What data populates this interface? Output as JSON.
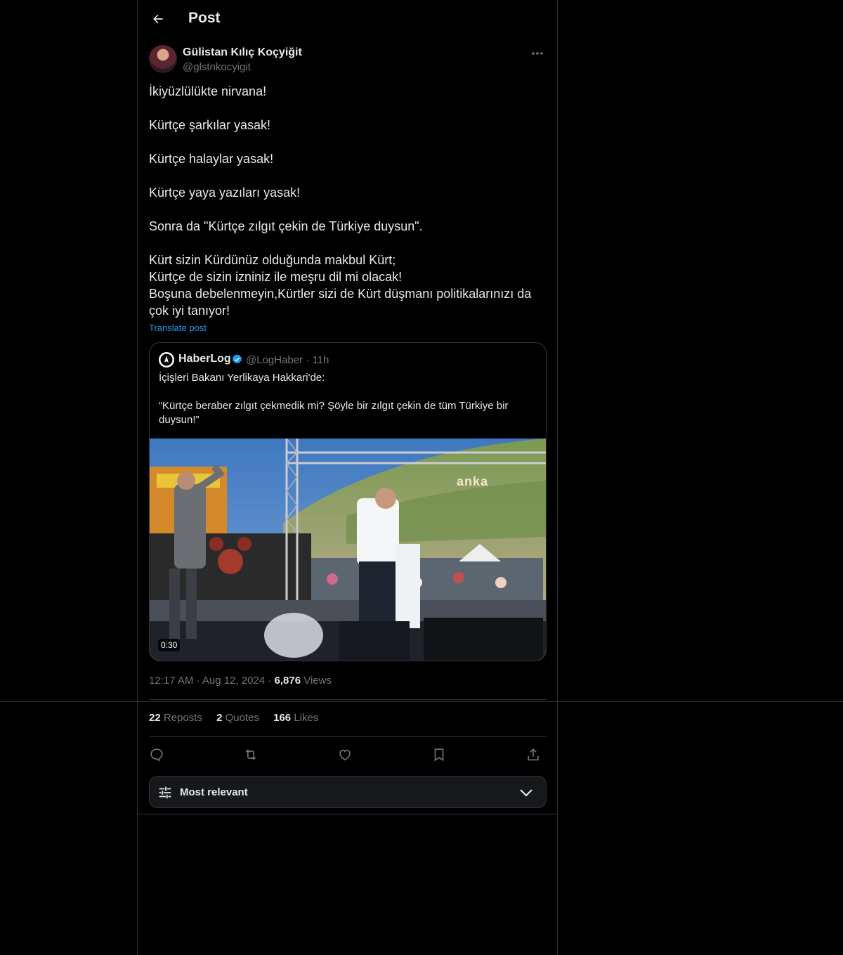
{
  "header": {
    "title": "Post"
  },
  "post": {
    "author_name": "Gülistan Kılıç Koçyiğit",
    "author_handle": "@glstnkocyigit",
    "text_lines": [
      "İkiyüzlülükte nirvana!",
      "",
      "Kürtçe şarkılar yasak!",
      "",
      "Kürtçe halaylar yasak!",
      "",
      "Kürtçe yaya yazıları yasak!",
      "",
      "Sonra da \"Kürtçe zılgıt çekin de Türkiye duysun\".",
      "",
      "Kürt sizin Kürdünüz olduğunda makbul Kürt;",
      "Kürtçe de sizin izniniz ile meşru dil mi olacak!",
      "Boşuna debelenmeyin,Kürtler sizi de Kürt düşmanı politikalarınızı da",
      "çok iyi tanıyor!"
    ],
    "translate_label": "Translate post",
    "time": "12:17 AM",
    "date": "Aug 12, 2024",
    "views_count": "6,876",
    "views_label": "Views",
    "reposts_count": "22",
    "reposts_label": "Reposts",
    "quotes_count": "2",
    "quotes_label": "Quotes",
    "likes_count": "166",
    "likes_label": "Likes"
  },
  "quoted": {
    "name": "HaberLog",
    "handle": "@LogHaber",
    "age": "11h",
    "text_lines": [
      "İçişleri Bakanı Yerlikaya Hakkari'de:",
      "",
      "“Kürtçe beraber zılgıt çekmedik mi? Şöyle bir zılgıt çekin de tüm Türkiye bir",
      "duysun!”"
    ],
    "video_duration": "0:30",
    "watermark": "anka"
  },
  "sort": {
    "label": "Most relevant"
  },
  "colors": {
    "accent": "#1d9bf0",
    "text": "#e7e9ea",
    "muted": "#71767b",
    "border": "#2f3336",
    "background": "#000000"
  },
  "icons": [
    "back-arrow-icon",
    "more-icon",
    "verified-badge-icon",
    "reply-icon",
    "repost-icon",
    "like-icon",
    "bookmark-icon",
    "share-icon",
    "sliders-icon",
    "chevron-down-icon"
  ]
}
